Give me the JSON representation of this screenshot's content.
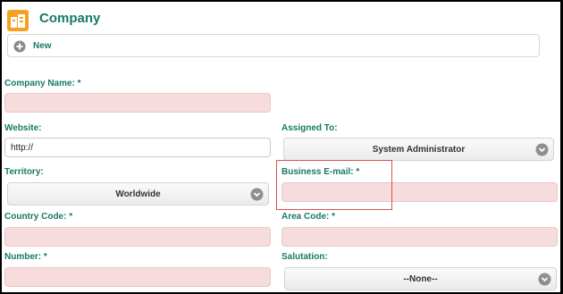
{
  "page": {
    "title": "Company"
  },
  "toolbar": {
    "new_label": "New"
  },
  "form": {
    "company_name": {
      "label": "Company Name: *",
      "value": ""
    },
    "website": {
      "label": "Website:",
      "value": "http://"
    },
    "assigned_to": {
      "label": "Assigned To:",
      "value": "System Administrator"
    },
    "territory": {
      "label": "Territory:",
      "value": "Worldwide"
    },
    "business_email": {
      "label": "Business E-mail: *",
      "value": ""
    },
    "country_code": {
      "label": "Country Code: *",
      "value": ""
    },
    "area_code": {
      "label": "Area Code: *",
      "value": ""
    },
    "number": {
      "label": "Number: *",
      "value": ""
    },
    "salutation": {
      "label": "Salutation:",
      "value": "--None--"
    }
  },
  "icons": {
    "app": "building-icon",
    "new": "plus-circle-icon",
    "dropdown": "chevron-down-icon"
  },
  "colors": {
    "accent": "#157a63",
    "app_icon": "#f4a020",
    "required_field": "#f6dcdc",
    "highlight": "#d9534f"
  }
}
